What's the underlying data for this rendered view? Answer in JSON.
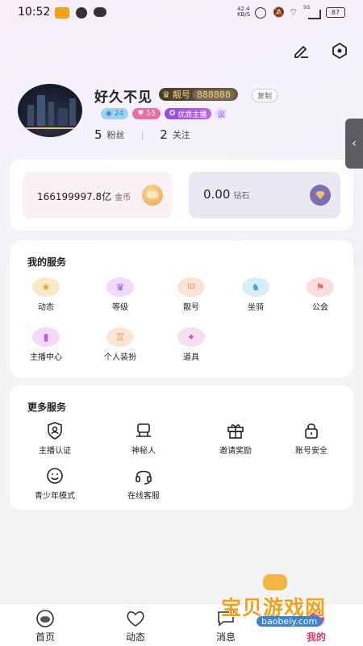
{
  "status_bar": {
    "time": "10:52",
    "net_speed": "42.4\nKB/S",
    "battery": "87",
    "signal_text": "5G"
  },
  "profile": {
    "name": "好久不见",
    "pretty_label": "靓号",
    "pretty_number": "888888",
    "copy_label": "复制",
    "tags": {
      "views": "24",
      "mic": "15",
      "quality": "优质主播",
      "circle": "议"
    },
    "fans_count": "5",
    "fans_label": "粉丝",
    "follow_count": "2",
    "follow_label": "关注"
  },
  "wallet": {
    "coins_value": "166199997.8亿",
    "coins_unit": "金币",
    "diamonds_value": "0.00",
    "diamonds_unit": "钻石"
  },
  "services": {
    "title": "我的服务",
    "items": [
      {
        "label": "动态"
      },
      {
        "label": "等级"
      },
      {
        "label": "靓号"
      },
      {
        "label": "坐骑"
      },
      {
        "label": "公会"
      },
      {
        "label": "主播中心"
      },
      {
        "label": "个人装扮"
      },
      {
        "label": "道具"
      }
    ]
  },
  "more_services": {
    "title": "更多服务",
    "items": [
      {
        "label": "主播认证"
      },
      {
        "label": "神秘人"
      },
      {
        "label": "邀请奖励"
      },
      {
        "label": "账号安全"
      },
      {
        "label": "青少年模式"
      },
      {
        "label": "在线客服"
      }
    ]
  },
  "bottom_nav": [
    {
      "label": "首页"
    },
    {
      "label": "动态"
    },
    {
      "label": "消息"
    },
    {
      "label": "我的"
    }
  ],
  "watermark": {
    "text": "宝贝游戏网",
    "url": "baobeiy.com"
  },
  "colors": {
    "accent": "#e23a5f",
    "pretty_gold": "#f6d37b",
    "watermark_orange": "#f0a21d"
  }
}
